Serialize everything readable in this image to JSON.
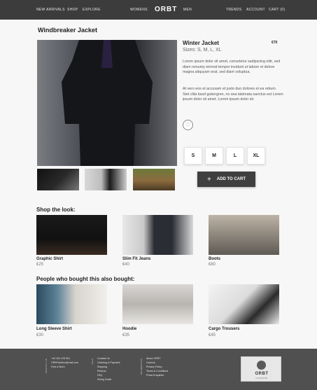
{
  "nav": {
    "left": [
      "NEW ARRIVALS",
      "SHOP",
      "EXPLORE"
    ],
    "women": "WOMENS",
    "logo": "ORBT",
    "men": "MEN",
    "right": [
      "TRENDS",
      "ACCOUNT",
      "CART (0)"
    ]
  },
  "product": {
    "page_title": "Windbreaker Jacket",
    "name": "Winter Jacket",
    "price": "€70",
    "sizes_text": "Sizes: S, M, L, XL",
    "desc_1": "Lorem ipsum dolor sit amet, consetetur sadipscing elitr, sed diam nonumy eirmod tempor invidunt ut labore et dolore magna aliquyam erat, sed diam voluptua.",
    "desc_2": "At vero eos et accusam et justo duo dolores et ea rebum. Stet clita kasd gubergren, no sea takimata sanctus est Lorem ipsum dolor sit amet. Lorem ipsum dolor sit.",
    "size_buttons": [
      "S",
      "M",
      "L",
      "XL"
    ],
    "add_to_cart": "ADD TO CART"
  },
  "shop_look": {
    "title": "Shop the look:",
    "items": [
      {
        "name": "Graphic Shirt",
        "price": "€25"
      },
      {
        "name": "Slim Fit Jeans",
        "price": "€40"
      },
      {
        "name": "Boots",
        "price": "€80"
      }
    ]
  },
  "also_bought": {
    "title": "People who bought this also bought:",
    "items": [
      {
        "name": "Long Sleeve Shirt",
        "price": "€30"
      },
      {
        "name": "Hoodie",
        "price": "€35"
      },
      {
        "name": "Cargo Trousers",
        "price": "€45"
      }
    ]
  },
  "footer": {
    "col1_head": "Contact Us",
    "col1": [
      "+44 342 478 901",
      "ORBTclothes@mail.com",
      "Find a Store"
    ],
    "col2_head": "Help",
    "col2": [
      "Contact Us",
      "Ordering & Payment",
      "Shipping",
      "Returns",
      "FAQ",
      "Sizing Guide"
    ],
    "col3_head": "Information",
    "col3": [
      "About ORBT",
      "Careers",
      "Privacy Policy",
      "Terms & Conditions",
      "Press Enquiries"
    ],
    "badge_logo": "ORBT",
    "badge_sub": "CLOTHING"
  },
  "icons": {
    "heart": "heart-icon",
    "plus": "plus-icon"
  }
}
